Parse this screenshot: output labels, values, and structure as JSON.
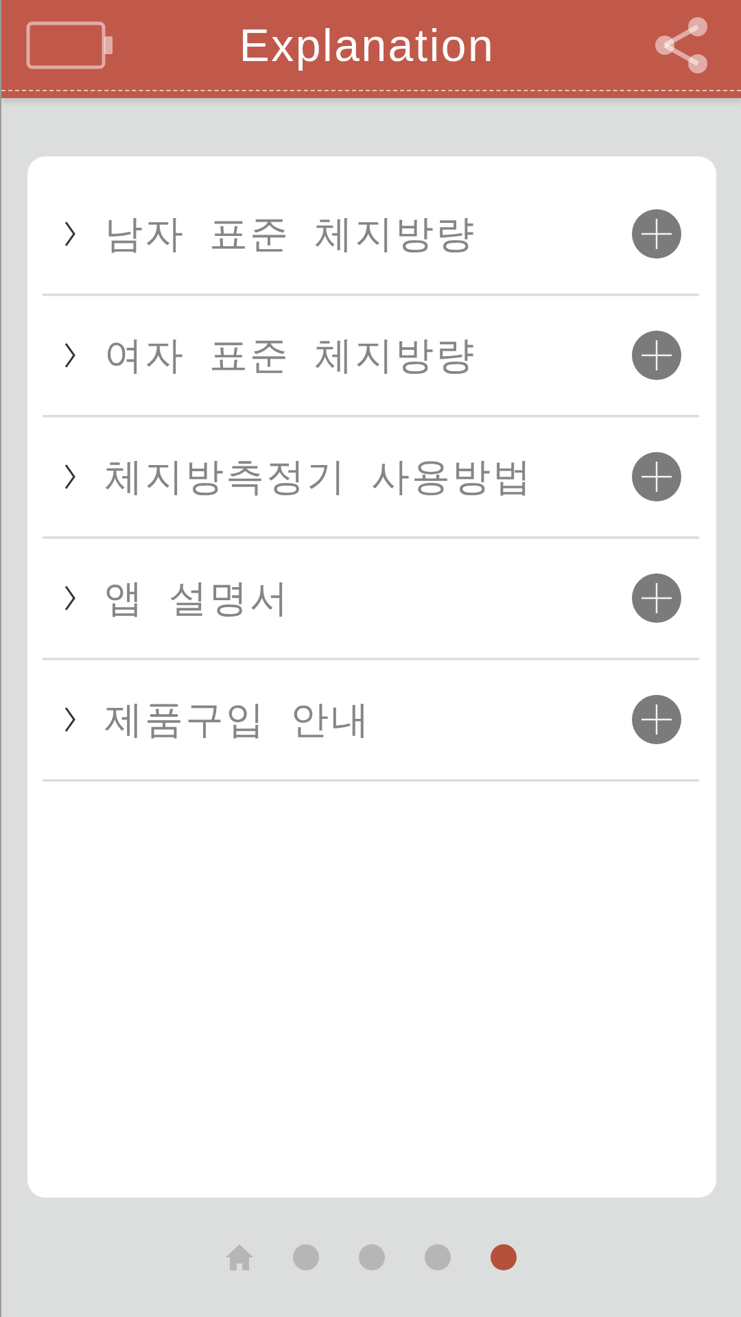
{
  "header": {
    "title": "Explanation"
  },
  "items": [
    {
      "label": "남자 표준 체지방량",
      "expanded": false
    },
    {
      "label": "여자 표준 체지방량",
      "expanded": false
    },
    {
      "label": "체지방측정기 사용방법",
      "expanded": false
    },
    {
      "label": "앱 설명서",
      "expanded": false
    },
    {
      "label": "제품구입 안내",
      "expanded": false
    }
  ],
  "pager": [
    {
      "kind": "home",
      "selected": false
    },
    {
      "kind": "dot",
      "selected": false
    },
    {
      "kind": "dot",
      "selected": false
    },
    {
      "kind": "dot",
      "selected": false
    },
    {
      "kind": "dot",
      "selected": true
    }
  ]
}
